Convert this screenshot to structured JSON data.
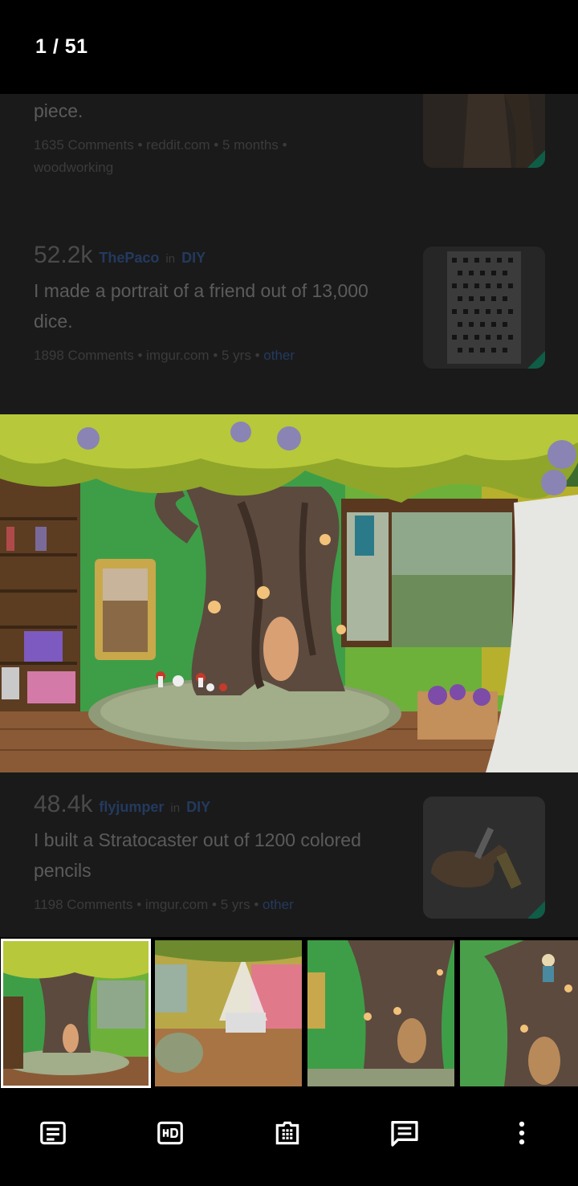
{
  "viewer": {
    "counter": "1 / 51"
  },
  "feed": {
    "posts": [
      {
        "score": "",
        "user": "",
        "in": "",
        "sub": "",
        "title": "piece.",
        "comments": "1635 Comments",
        "domain": "reddit.com",
        "age": "5 months",
        "flair": "woodworking"
      },
      {
        "score": "52.2k",
        "user": "ThePaco",
        "in": "in",
        "sub": "DIY",
        "title": "I made a portrait of a friend out of 13,000 dice.",
        "comments": "1898 Comments",
        "domain": "imgur.com",
        "age": "5 yrs",
        "flair": "other"
      },
      {
        "score": "48.4k",
        "user": "flyjumper",
        "in": "in",
        "sub": "DIY",
        "title": "I built a Stratocaster out of 1200 colored pencils",
        "comments": "1198 Comments",
        "domain": "imgur.com",
        "age": "5 yrs",
        "flair": "other"
      }
    ],
    "separator": "•"
  },
  "toolbar": {
    "icons": [
      "description-icon",
      "hd-icon",
      "gallery-icon",
      "comments-icon",
      "more-vert-icon"
    ]
  },
  "colors": {
    "accent_link": "#233a5f",
    "thumb_corner": "#0f5d46",
    "selected_outline": "#ffffff"
  }
}
